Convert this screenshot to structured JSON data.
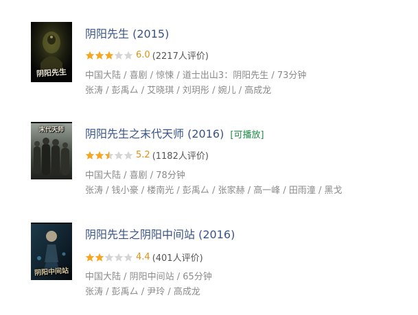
{
  "colors": {
    "title": "#37528a",
    "score": "#e09015",
    "playable": "#1d8c45",
    "meta": "#8a8a8a",
    "star_on": "#f5a623",
    "star_off": "#d5d5d5"
  },
  "items": [
    {
      "poster_text": "阴阳先生",
      "poster_icon": "movie-poster",
      "title": "阴阳先生",
      "year": "(2015)",
      "playable": "",
      "stars": 3,
      "score": "6.0",
      "count": "(2217人评价)",
      "meta": "中国大陆 / 喜剧 / 惊悚 / 道士出山3：阴阳先生 / 73分钟",
      "cast": "张涛 / 彭禹厶 / 艾晓琪 / 刘玥彤 / 婉儿 / 高成龙"
    },
    {
      "poster_text": "末代天师",
      "poster_icon": "movie-poster",
      "title": "阴阳先生之末代天师",
      "year": "(2016)",
      "playable": "[可播放]",
      "stars": 2.5,
      "score": "5.2",
      "count": "(1182人评价)",
      "meta": "中国大陆 / 喜剧 / 78分钟",
      "cast": "张涛 / 钱小豪 / 楼南光 / 彭禹厶 / 张家赫 / 高一峰 / 田雨潼 / 黑戈"
    },
    {
      "poster_text": "阴阳中间站",
      "poster_icon": "movie-poster",
      "title": "阴阳先生之阴阳中间站",
      "year": "(2016)",
      "playable": "",
      "stars": 2,
      "score": "4.4",
      "count": "(401人评价)",
      "meta": "中国大陆 / 阴阳中间站 / 65分钟",
      "cast": "张涛 / 彭禹厶 / 尹玲 / 高成龙"
    }
  ]
}
